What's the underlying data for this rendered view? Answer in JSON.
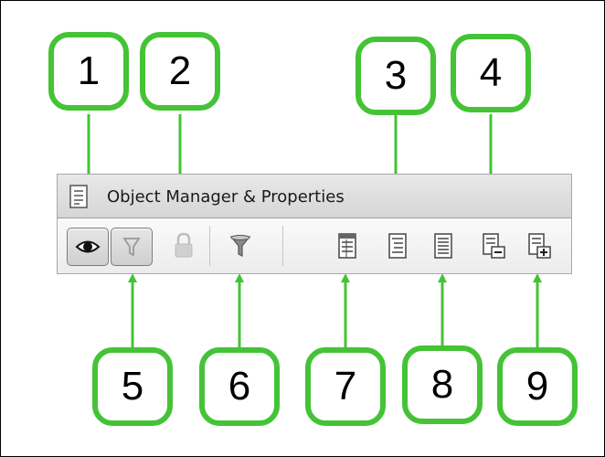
{
  "panel": {
    "title": "Object Manager & Properties",
    "icons": {
      "header": "object-manager-icon",
      "show_objects": "eye-icon",
      "show_filter": "filter-icon",
      "lock": "lock-icon",
      "filter": "funnel-icon",
      "btn7": "property-list-icon",
      "btn3": "property-grid-icon",
      "btn8": "property-sheet-icon",
      "collapse": "collapse-all-icon",
      "expand": "expand-all-icon"
    }
  },
  "callouts": [
    "1",
    "2",
    "3",
    "4",
    "5",
    "6",
    "7",
    "8",
    "9"
  ],
  "colors": {
    "callout_green": "#44c336"
  }
}
